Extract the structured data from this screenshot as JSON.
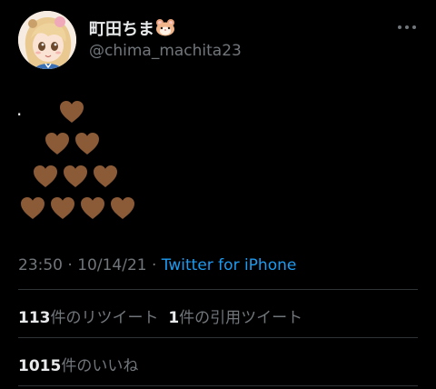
{
  "user": {
    "display_name": "町田ちま",
    "name_emoji": "hamster-face-emoji",
    "handle": "@chima_machita23",
    "avatar": "anime-girl-avatar"
  },
  "tweet": {
    "text_prefix": ".",
    "heart_rows": [
      1,
      2,
      3,
      4
    ],
    "heart_emoji": "brown-heart",
    "heart_color": "#8b5a36"
  },
  "meta": {
    "time": "23:50",
    "sep1": " · ",
    "date": "10/14/21",
    "sep2": " · ",
    "source": "Twitter for iPhone"
  },
  "stats": {
    "retweets_count": "113",
    "retweets_label": "件のリツイート",
    "quotes_count": "1",
    "quotes_label": "件の引用ツイート",
    "likes_count": "1015",
    "likes_label": "件のいいね"
  },
  "colors": {
    "background": "#000000",
    "text": "#e7e9ea",
    "secondary": "#71767b",
    "link": "#1d9bf0",
    "divider": "#2f3336"
  }
}
